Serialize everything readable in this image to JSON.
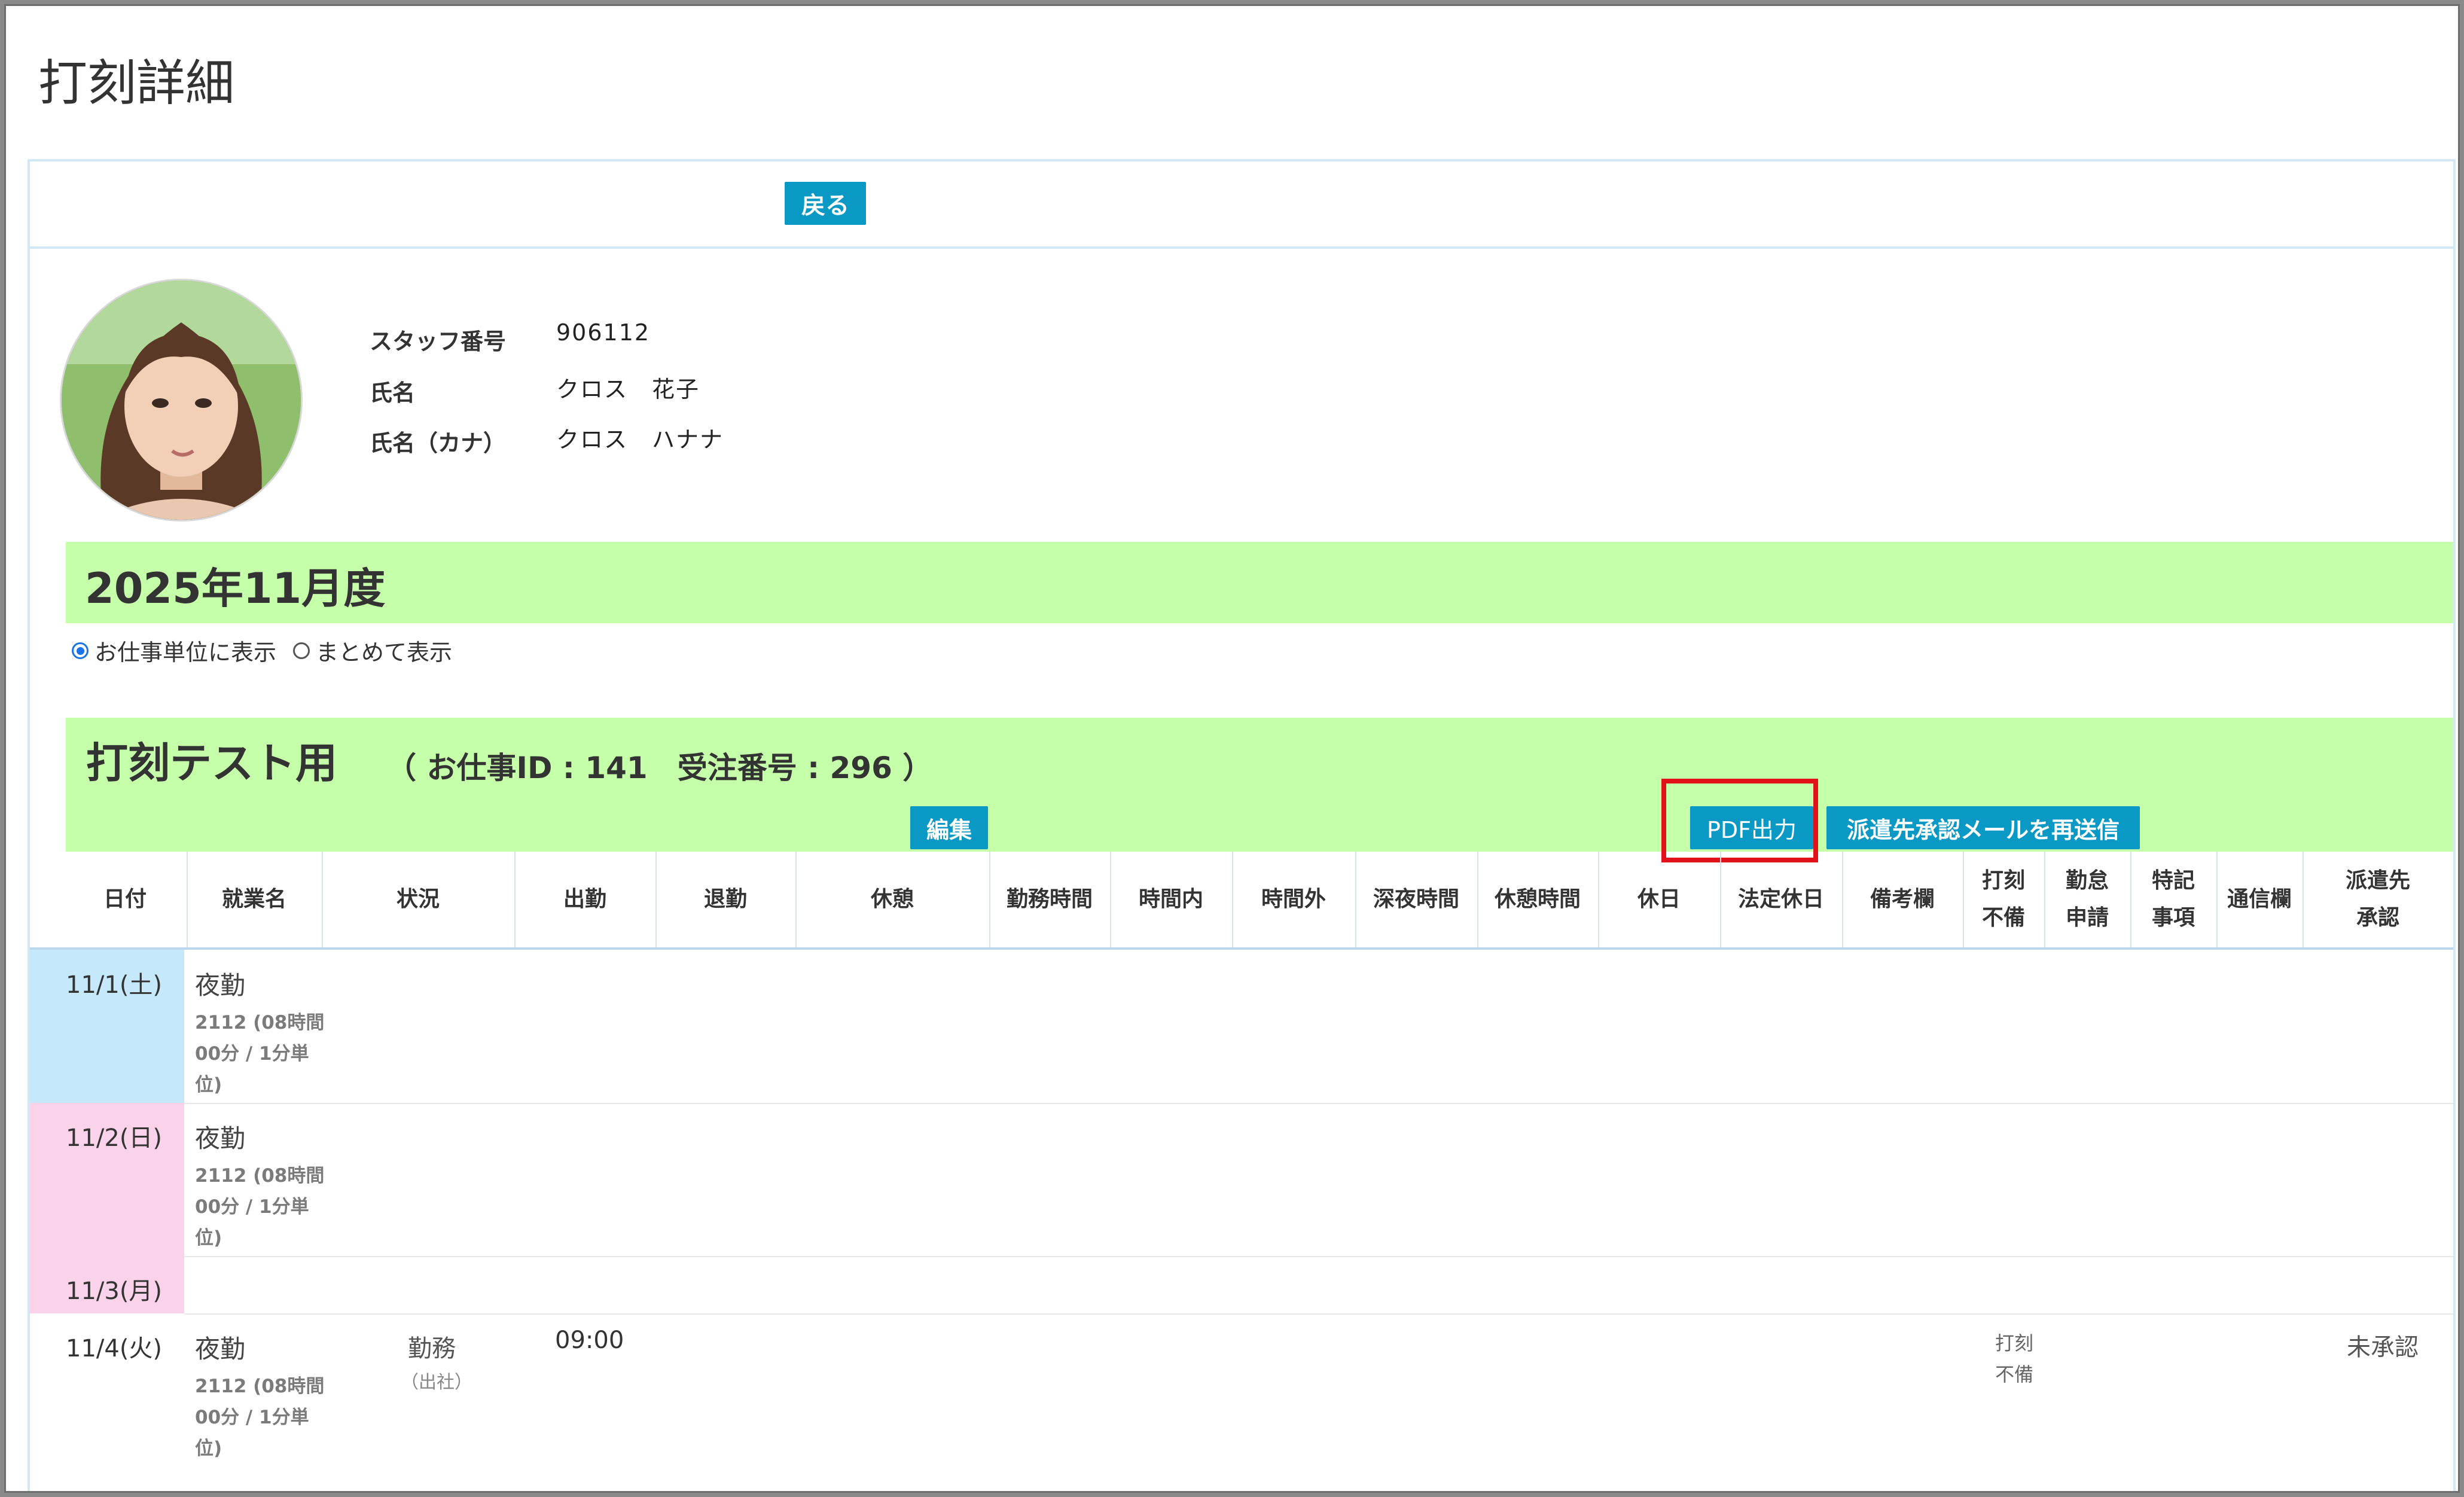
{
  "page_title": "打刻詳細",
  "toolbar": {
    "back_label": "戻る"
  },
  "staff": {
    "number_label": "スタッフ番号",
    "number_value": "906112",
    "name_label": "氏名",
    "name_value": "クロス　花子",
    "kana_label": "氏名（カナ）",
    "kana_value": "クロス　ハナナ"
  },
  "month": {
    "title": "2025年11月度"
  },
  "view_options": {
    "per_job": "お仕事単位に表示",
    "combined": "まとめて表示",
    "selected": "per_job"
  },
  "job": {
    "title": "打刻テスト用",
    "meta": "（ お仕事ID : 141　受注番号 : 296 ）",
    "edit_label": "編集",
    "pdf_label": "PDF出力",
    "resend_label": "派遣先承認メールを再送信"
  },
  "table": {
    "headers": [
      "日付",
      "就業名",
      "状況",
      "出勤",
      "退勤",
      "休憩",
      "勤務時間",
      "時間内",
      "時間外",
      "深夜時間",
      "休憩時間",
      "休日",
      "法定休日",
      "備考欄",
      "打刻\n不備",
      "勤怠\n申請",
      "特記\n事項",
      "通信欄",
      "派遣先\n承認"
    ],
    "rows": [
      {
        "date": "11/1(土)",
        "job_name": "夜勤",
        "job_detail": "2112 (08時間00分 / 1分単位)",
        "status": "",
        "status_sub": "",
        "in": "",
        "uchi_fubi": "",
        "approval": "",
        "color": "#c5e8fa"
      },
      {
        "date": "11/2(日)",
        "job_name": "夜勤",
        "job_detail": "2112 (08時間00分 / 1分単位)",
        "status": "",
        "status_sub": "",
        "in": "",
        "uchi_fubi": "",
        "approval": "",
        "color": "#fad3ea"
      },
      {
        "date": "11/3(月)",
        "job_name": "",
        "job_detail": "",
        "status": "",
        "status_sub": "",
        "in": "",
        "uchi_fubi": "",
        "approval": "",
        "color": "#fad3ea"
      },
      {
        "date": "11/4(火)",
        "job_name": "夜勤",
        "job_detail": "2112 (08時間00分 / 1分単位)",
        "status": "勤務",
        "status_sub": "（出社）",
        "in": "09:00",
        "uchi_fubi": "打刻\n不備",
        "approval": "未承認",
        "color": "#ffffff"
      }
    ]
  },
  "colors": {
    "accent_button": "#0a98c5",
    "band_green": "#c6ffaa",
    "highlight_red": "#e2121a"
  }
}
